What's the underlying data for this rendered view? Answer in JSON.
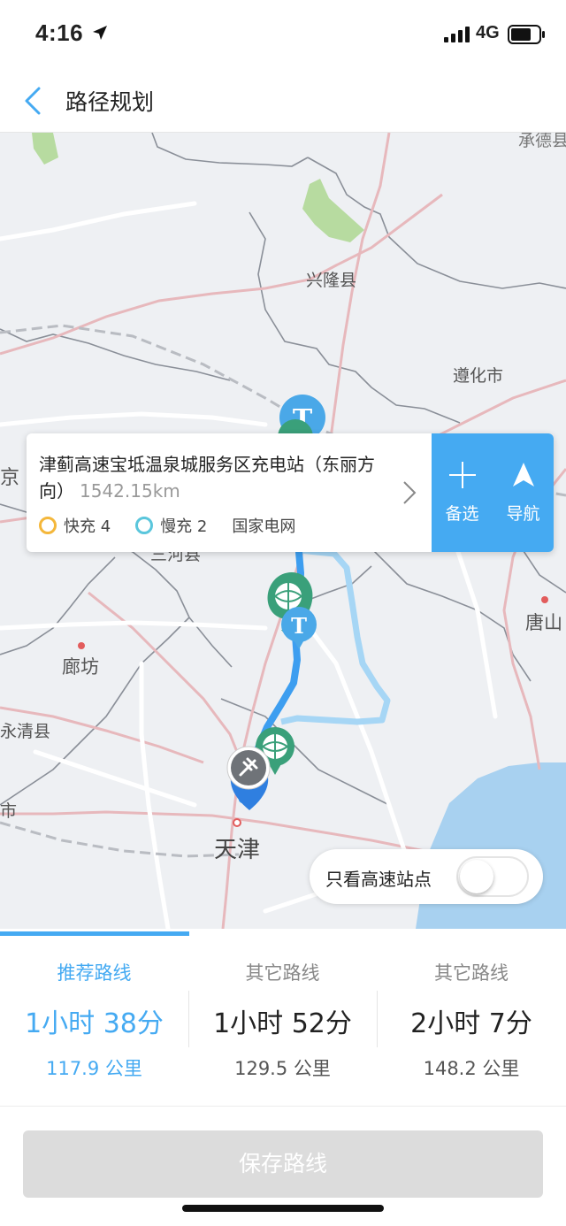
{
  "status_bar": {
    "time": "4:16",
    "network": "4G"
  },
  "nav": {
    "title": "路径规划"
  },
  "map": {
    "labels": {
      "xinglong": "兴隆县",
      "zunhua": "遵化市",
      "chengde": "承德县",
      "jing": "京",
      "sanhe": "三河县",
      "langfang": "廊坊",
      "yongqing": "永清县",
      "shi": "市",
      "tangshan": "唐山",
      "tianjin": "天津"
    },
    "colors": {
      "route": "#3d9ef0",
      "route_alt": "#a6d6f5",
      "station_green": "#3aa07a",
      "station_blue": "#2f91e8"
    }
  },
  "station_card": {
    "name": "津蓟高速宝坻温泉城服务区充电站（东丽方向）",
    "distance": "1542.15km",
    "fast_label": "快充 4",
    "slow_label": "慢充 2",
    "operator": "国家电网",
    "add_label": "备选",
    "navigate_label": "导航"
  },
  "highway_toggle": {
    "label": "只看高速站点",
    "on": false
  },
  "routes": [
    {
      "label": "推荐路线",
      "time": "1小时 38分",
      "distance": "117.9 公里",
      "active": true
    },
    {
      "label": "其它路线",
      "time": "1小时 52分",
      "distance": "129.5 公里",
      "active": false
    },
    {
      "label": "其它路线",
      "time": "2小时 7分",
      "distance": "148.2 公里",
      "active": false
    }
  ],
  "save_button": {
    "label": "保存路线"
  }
}
